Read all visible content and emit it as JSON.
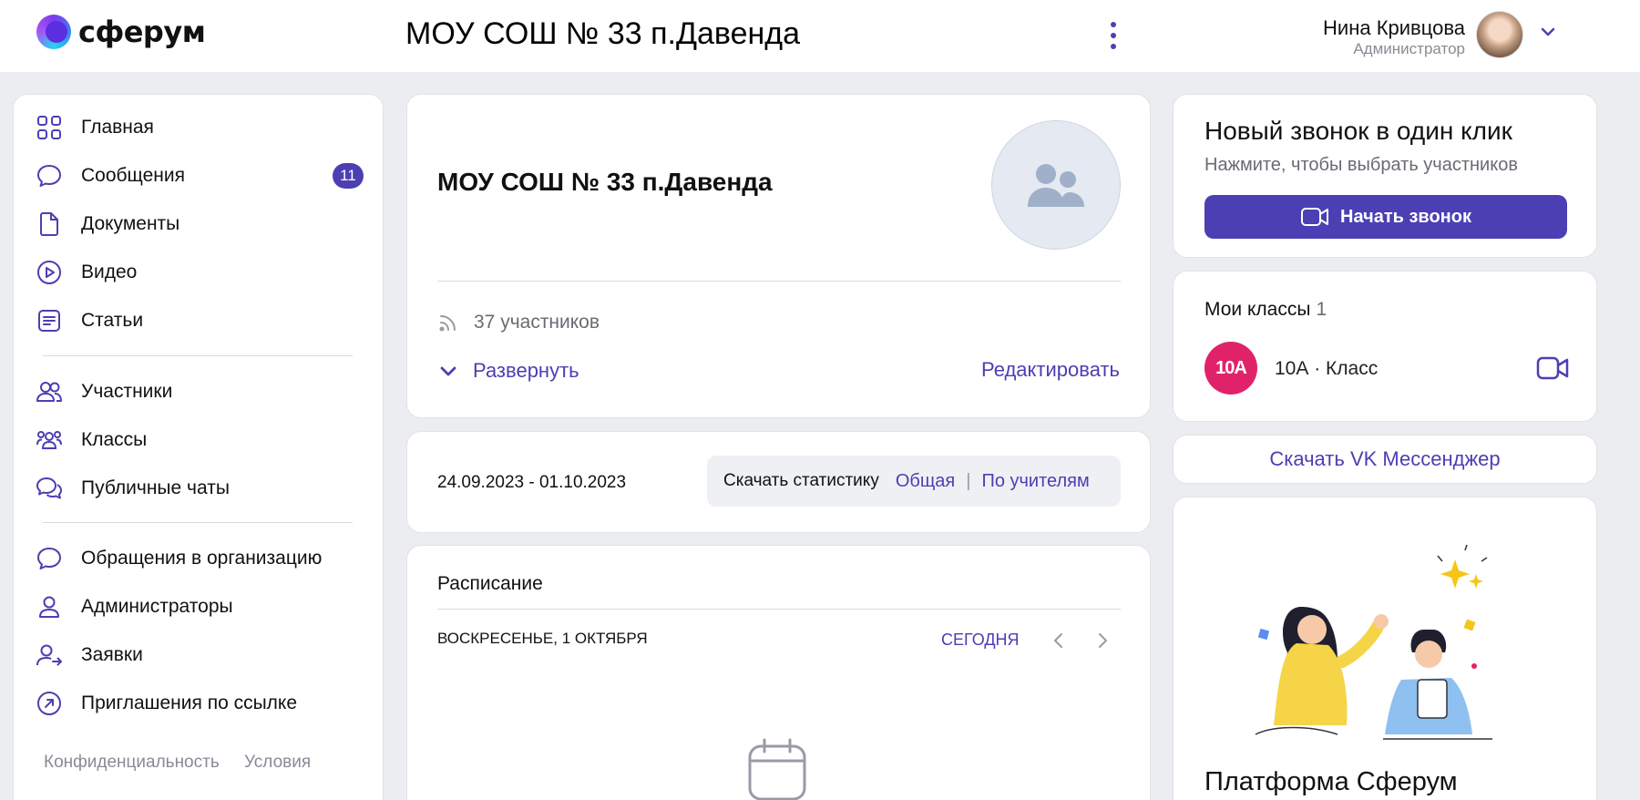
{
  "header": {
    "logo_text": "сферум",
    "org_title": "МОУ СОШ № 33 п.Давенда",
    "user_name": "Нина Кривцова",
    "user_role": "Администратор"
  },
  "sidebar": {
    "items": [
      {
        "label": "Главная",
        "icon": "home-grid-icon"
      },
      {
        "label": "Сообщения",
        "icon": "chat-icon",
        "badge": "11"
      },
      {
        "label": "Документы",
        "icon": "document-icon"
      },
      {
        "label": "Видео",
        "icon": "play-icon"
      },
      {
        "label": "Статьи",
        "icon": "article-icon"
      },
      {
        "label": "Участники",
        "icon": "users-icon"
      },
      {
        "label": "Классы",
        "icon": "classes-icon"
      },
      {
        "label": "Публичные чаты",
        "icon": "public-chats-icon"
      },
      {
        "label": "Обращения в организацию",
        "icon": "chat-icon"
      },
      {
        "label": "Администраторы",
        "icon": "user-icon"
      },
      {
        "label": "Заявки",
        "icon": "user-arrow-icon"
      },
      {
        "label": "Приглашения по ссылке",
        "icon": "link-arrow-icon"
      }
    ],
    "footer": {
      "privacy": "Конфиденциальность",
      "terms": "Условия"
    }
  },
  "group": {
    "name": "МОУ СОШ № 33 п.Давенда",
    "members": "37 участников",
    "expand": "Развернуть",
    "edit": "Редактировать"
  },
  "stats": {
    "date_range": "24.09.2023 - 01.10.2023",
    "label": "Скачать статистику",
    "general": "Общая",
    "separator": "|",
    "by_teachers": "По учителям"
  },
  "schedule": {
    "title": "Расписание",
    "date": "ВОСКРЕСЕНЬЕ, 1 ОКТЯБРЯ",
    "today": "СЕГОДНЯ"
  },
  "call": {
    "title": "Новый звонок в один клик",
    "subtitle": "Нажмите, чтобы выбрать участников",
    "button": "Начать звонок"
  },
  "classes": {
    "title": "Мои классы",
    "count": "1",
    "items": [
      {
        "avatar": "10А",
        "name": "10А · Класс"
      }
    ]
  },
  "vk": {
    "label": "Скачать VK Мессенджер"
  },
  "promo": {
    "title": "Платформа Сферум"
  },
  "colors": {
    "accent": "#4b3fb3",
    "class_avatar": "#e0226b",
    "background": "#ecedf1"
  }
}
